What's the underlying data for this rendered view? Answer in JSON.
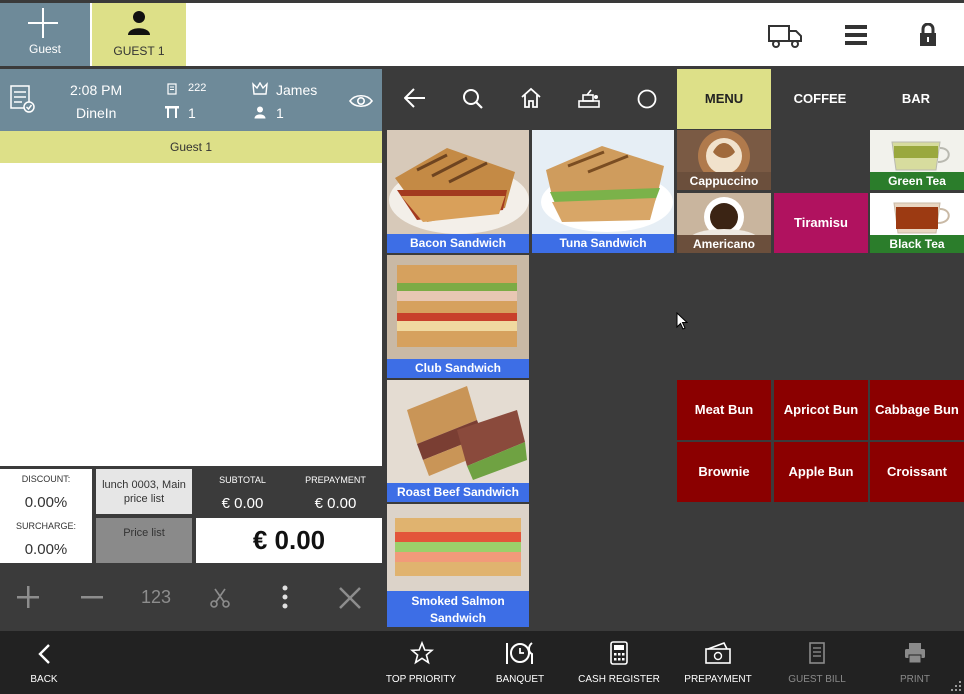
{
  "top": {
    "add_guest_label": "Guest",
    "guest_tab_label": "GUEST 1"
  },
  "info": {
    "time": "2:08 PM",
    "order_type": "DineIn",
    "order_number": "222",
    "table": "1",
    "waiter": "James",
    "guests": "1"
  },
  "guest_strip": "Guest 1",
  "totals": {
    "discount_label": "DISCOUNT:",
    "discount_value": "0.00%",
    "surcharge_label": "SURCHARGE:",
    "surcharge_value": "0.00%",
    "price_list_current": "lunch 0003, Main price list",
    "price_list_button": "Price list",
    "subtotal_label": "SUBTOTAL",
    "subtotal_value": "€ 0.00",
    "prepayment_label": "PREPAYMENT",
    "prepayment_value": "€ 0.00",
    "total_value": "€ 0.00"
  },
  "actions": {
    "numpad_label": "123"
  },
  "categories": [
    {
      "label": "MENU",
      "selected": true
    },
    {
      "label": "COFFEE",
      "selected": false
    },
    {
      "label": "BAR",
      "selected": false
    }
  ],
  "products": {
    "bacon": "Bacon Sandwich",
    "tuna": "Tuna Sandwich",
    "club": "Club Sandwich",
    "roastbeef": "Roast Beef Sandwich",
    "salmon": "Smoked Salmon Sandwich",
    "cappuccino": "Cappuccino",
    "americano": "Americano",
    "tiramisu": "Tiramisu",
    "greentea": "Green Tea",
    "blacktea": "Black Tea",
    "meatbun": "Meat Bun",
    "apricotbun": "Apricot Bun",
    "cabbagebun": "Cabbage Bun",
    "brownie": "Brownie",
    "applebun": "Apple Bun",
    "croissant": "Croissant"
  },
  "bottom": {
    "back": "BACK",
    "top_priority": "TOP PRIORITY",
    "banquet": "BANQUET",
    "cash_register": "CASH REGISTER",
    "prepayment": "PREPAYMENT",
    "guest_bill": "GUEST BILL",
    "print": "PRINT"
  },
  "colors": {
    "accent_yellow": "#dde088",
    "slate": "#6e8a99",
    "tile_red": "#8b0000",
    "tiramisu": "#b0125f",
    "caption_blue": "#3d6ee6",
    "caption_green": "#2b7d2b"
  },
  "icons": [
    "plus-icon",
    "user-icon",
    "truck-icon",
    "menu-icon",
    "lock-icon",
    "receipt-icon",
    "document-icon",
    "table-icon",
    "crown-icon",
    "person-icon",
    "eye-icon",
    "back-arrow-icon",
    "search-icon",
    "home-icon",
    "cashier-icon",
    "circle-icon",
    "scissors-icon",
    "more-icon",
    "close-icon",
    "star-icon",
    "banquet-icon",
    "calculator-icon",
    "prepayment-icon",
    "bill-icon",
    "printer-icon"
  ]
}
